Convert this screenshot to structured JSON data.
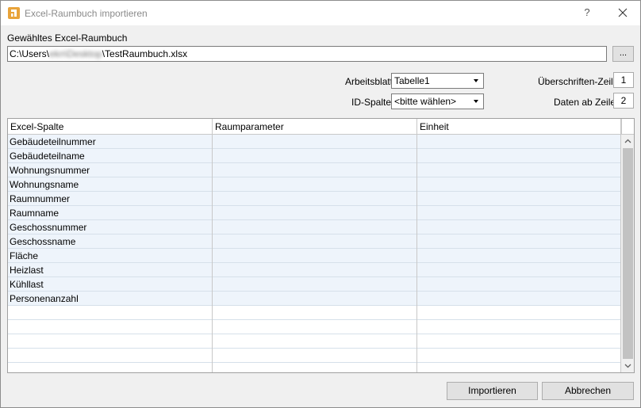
{
  "window": {
    "title": "Excel-Raumbuch importieren",
    "help": "?",
    "accent_icon_color": "#e8a33a"
  },
  "file": {
    "label": "Gewähltes Excel-Raumbuch",
    "path_prefix": "C:\\Users\\",
    "path_blurred": "ekn\\Desktop",
    "path_suffix": "\\TestRaumbuch.xlsx",
    "browse_label": "..."
  },
  "settings": {
    "sheet_label": "Arbeitsblatt",
    "sheet_value": "Tabelle1",
    "id_label": "ID-Spalte",
    "id_value": "<bitte wählen>",
    "header_row_label": "Überschriften-Zeile",
    "header_row_value": "1",
    "data_row_label": "Daten ab Zeile",
    "data_row_value": "2"
  },
  "grid": {
    "columns": [
      "Excel-Spalte",
      "Raumparameter",
      "Einheit"
    ],
    "rows": [
      [
        "Gebäudeteilnummer",
        "",
        ""
      ],
      [
        "Gebäudeteilname",
        "",
        ""
      ],
      [
        "Wohnungsnummer",
        "",
        ""
      ],
      [
        "Wohnungsname",
        "",
        ""
      ],
      [
        "Raumnummer",
        "",
        ""
      ],
      [
        "Raumname",
        "",
        ""
      ],
      [
        "Geschossnummer",
        "",
        ""
      ],
      [
        "Geschossname",
        "",
        ""
      ],
      [
        "Fläche",
        "",
        ""
      ],
      [
        "Heizlast",
        "",
        ""
      ],
      [
        "Kühllast",
        "",
        ""
      ],
      [
        "Personenanzahl",
        "",
        ""
      ]
    ],
    "empty_rows": 5
  },
  "buttons": {
    "import": "Importieren",
    "cancel": "Abbrechen"
  }
}
